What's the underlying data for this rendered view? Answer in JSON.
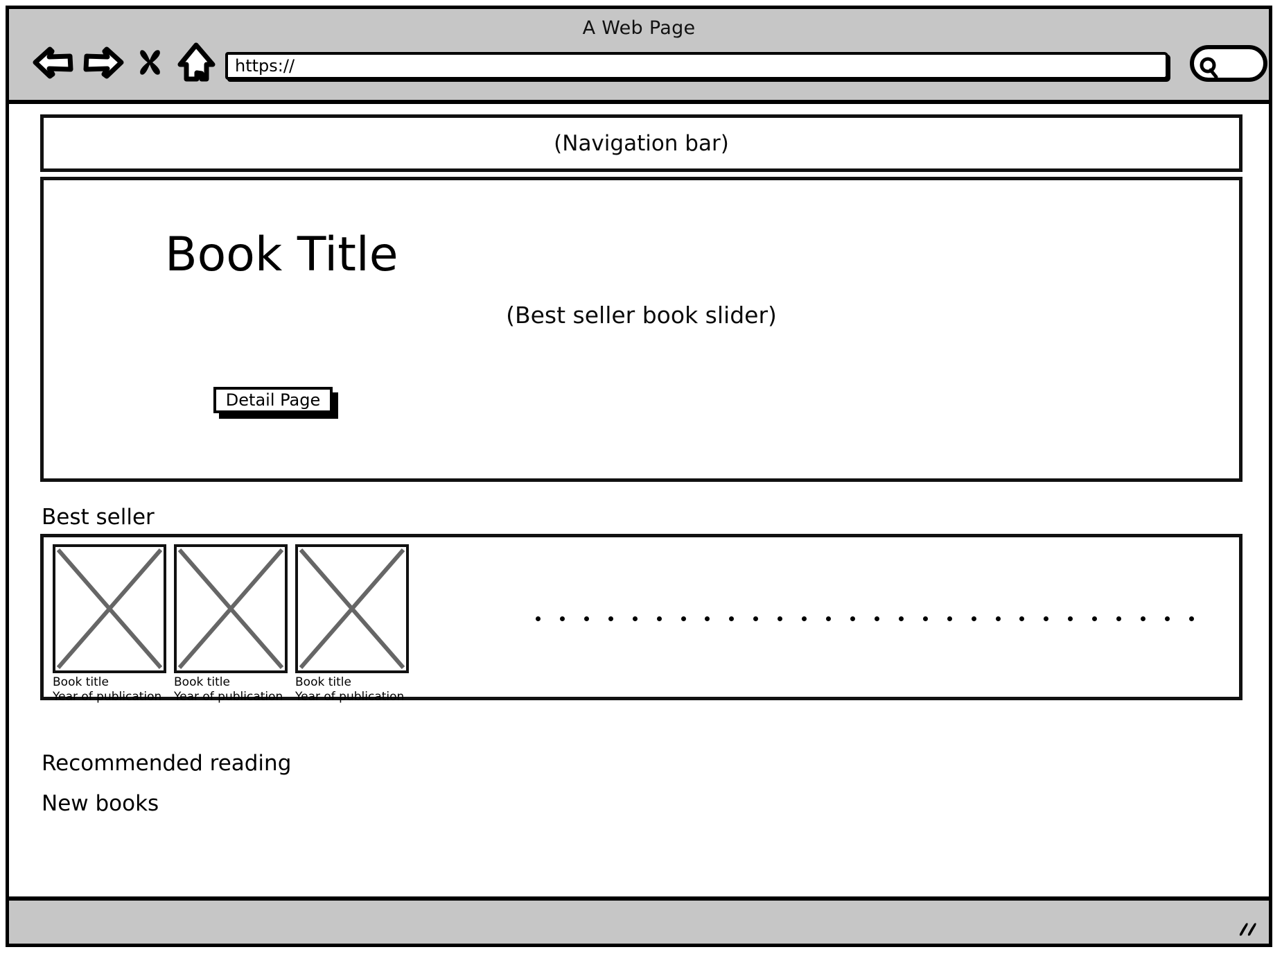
{
  "window": {
    "title": "A Web Page",
    "url_value": "https://",
    "url_placeholder": "https://"
  },
  "toolbar": {
    "back_icon": "back-arrow-icon",
    "forward_icon": "forward-arrow-icon",
    "stop_icon": "close-x-icon",
    "home_icon": "home-icon",
    "search_icon": "search-icon",
    "search_value": "",
    "search_placeholder": ""
  },
  "page": {
    "navigation_bar_label": "(Navigation bar)",
    "hero": {
      "title": "Book Title",
      "slider_label": "(Best seller book slider)",
      "cta_label": "Detail Page"
    },
    "sections": {
      "best_seller_heading": "Best seller",
      "recommended_heading": "Recommended reading",
      "new_books_heading": "New books"
    },
    "best_seller_cards": [
      {
        "thumb_icon": "image-placeholder-icon",
        "title": "Book title",
        "year": "Year of publication"
      },
      {
        "thumb_icon": "image-placeholder-icon",
        "title": "Book title",
        "year": "Year of publication"
      },
      {
        "thumb_icon": "image-placeholder-icon",
        "title": "Book title",
        "year": "Year of publication"
      }
    ],
    "dot_count": 28
  },
  "statusbar": {
    "resize_icon": "resize-grip-icon"
  },
  "colors": {
    "chrome_gray": "#c6c6c6",
    "ink": "#000000",
    "placeholder_x": "#666666",
    "canvas": "#ffffff"
  }
}
